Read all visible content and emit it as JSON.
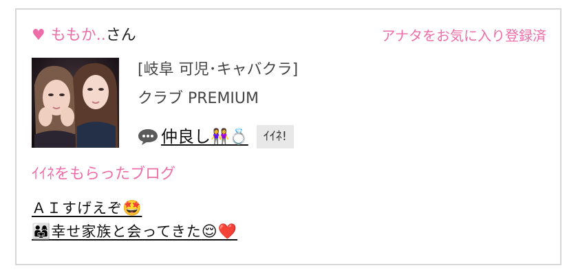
{
  "profile": {
    "name": "ももか..",
    "honorific": "さん",
    "favorite_status": "アナタをお気に入り登録済",
    "location_category": "[岐阜 可児･キャバクラ]",
    "shop_name": "クラブ PREMIUM",
    "heart_icon": "heart-icon",
    "colors": {
      "accent": "#ee6da8",
      "border": "#d6d6d6",
      "button_bg": "#e8e8e8"
    }
  },
  "message": {
    "icon": "speech-bubble-icon",
    "text": "仲良し",
    "emoji": "👭💍"
  },
  "like_button": {
    "label": "ｲｲﾈ!"
  },
  "blogs": {
    "heading": "ｲｲﾈをもらったブログ",
    "items": [
      {
        "prefix_emoji": "",
        "title": "ＡＩすげえぞ",
        "suffix_emoji": "🤩"
      },
      {
        "prefix_emoji": "👨‍👩‍👧",
        "title": "幸せ家族と会ってきた",
        "suffix_emoji": "😌❤️"
      }
    ]
  }
}
